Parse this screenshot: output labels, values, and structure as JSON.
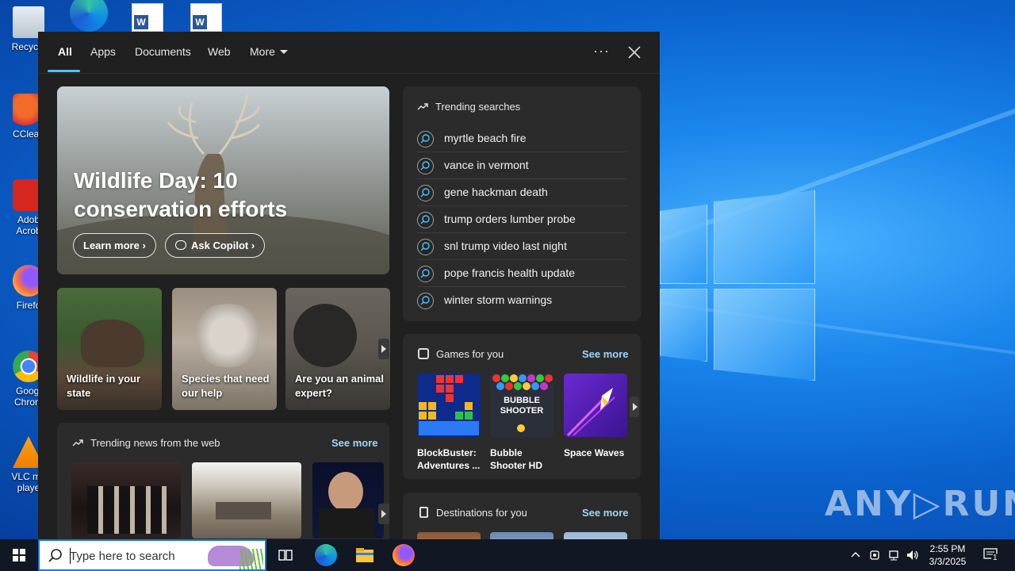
{
  "desktop": {
    "watermark": "ANY▷RUN",
    "icons": [
      {
        "label": "Recycle",
        "icon": "recycle-bin-icon"
      },
      {
        "label": "CClean",
        "icon": "ccleaner-icon"
      },
      {
        "label": "Adob\nAcrob",
        "icon": "adobe-acrobat-icon"
      },
      {
        "label": "Firefo",
        "icon": "firefox-icon"
      },
      {
        "label": "Googl\nChrom",
        "icon": "chrome-icon"
      },
      {
        "label": "VLC me\nplaye",
        "icon": "vlc-icon"
      }
    ]
  },
  "search_panel": {
    "tabs": [
      {
        "label": "All",
        "active": true
      },
      {
        "label": "Apps"
      },
      {
        "label": "Documents"
      },
      {
        "label": "Web"
      },
      {
        "label": "More"
      }
    ],
    "options_label": "···",
    "hero": {
      "title": "Wildlife Day: 10 conservation efforts",
      "learn_more": "Learn more",
      "ask_copilot": "Ask Copilot"
    },
    "cards": [
      {
        "caption": "Wildlife in your state"
      },
      {
        "caption": "Species that need our help"
      },
      {
        "caption": "Are you an animal expert?"
      }
    ],
    "trending_news": {
      "title": "Trending news from the web",
      "see_more": "See more"
    },
    "trending_searches": {
      "title": "Trending searches",
      "items": [
        "myrtle beach fire",
        "vance in vermont",
        "gene hackman death",
        "trump orders lumber probe",
        "snl trump video last night",
        "pope francis health update",
        "winter storm warnings"
      ]
    },
    "games": {
      "title": "Games for you",
      "see_more": "See more",
      "items": [
        {
          "name": "BlockBuster: Adventures ..."
        },
        {
          "name": "Bubble Shooter HD",
          "art_text": "BUBBLE SHOOTER"
        },
        {
          "name": "Space Waves"
        }
      ]
    },
    "destinations": {
      "title": "Destinations for you",
      "see_more": "See more"
    }
  },
  "taskbar": {
    "search_placeholder": "Type here to search",
    "time": "2:55 PM",
    "date": "3/3/2025",
    "notification_count": "1"
  },
  "colors": {
    "accent": "#4cc2ff",
    "panel_bg": "#202020",
    "card_bg": "#2b2b2b",
    "link": "#9fd6ff"
  }
}
